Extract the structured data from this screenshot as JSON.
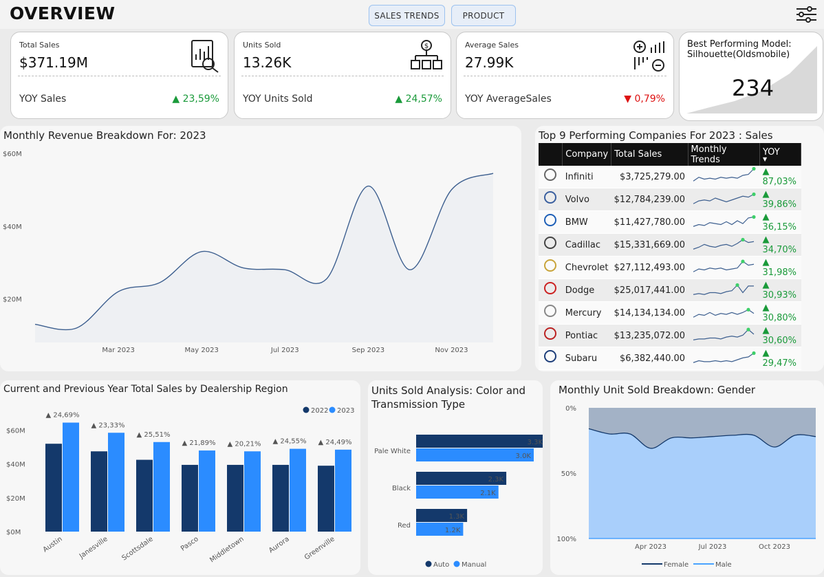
{
  "header": {
    "title": "OVERVIEW",
    "nav": [
      {
        "label": "SALES TRENDS"
      },
      {
        "label": "PRODUCT"
      }
    ]
  },
  "kpis": [
    {
      "label": "Total Sales",
      "value": "$371.19M",
      "yoy_label": "YOY Sales",
      "yoy_pct": "▲ 23,59%",
      "direction": "up",
      "icon": "report-magnifier-icon"
    },
    {
      "label": "Units Sold",
      "value": "13.26K",
      "yoy_label": "YOY Units Sold",
      "yoy_pct": "▲ 24,57%",
      "direction": "up",
      "icon": "dollar-boxes-icon"
    },
    {
      "label": "Average Sales",
      "value": "27.99K",
      "yoy_label": "YOY AverageSales",
      "yoy_pct": "▼ 0,79%",
      "direction": "down",
      "icon": "calc-chart-icon"
    }
  ],
  "best_model": {
    "label": "Best Performing Model:",
    "model": "Silhouette(Oldsmobile)",
    "value": "234"
  },
  "colors": {
    "navy": "#14396b",
    "blue": "#2b8cff",
    "line": "#3d5f8f",
    "up": "#1a9a3a",
    "down": "#dd1111",
    "spark_dot": "#3ecf6a"
  },
  "revenue_chart": {
    "title": "Monthly Revenue Breakdown For: 2023",
    "chart_data": {
      "type": "area",
      "x": [
        "Jan 2023",
        "Feb 2023",
        "Mar 2023",
        "Apr 2023",
        "May 2023",
        "Jun 2023",
        "Jul 2023",
        "Aug 2023",
        "Sep 2023",
        "Oct 2023",
        "Nov 2023",
        "Dec 2023"
      ],
      "x_tick_labels": [
        "Mar 2023",
        "May 2023",
        "Jul 2023",
        "Sep 2023",
        "Nov 2023"
      ],
      "y_tick_labels": [
        "$20M",
        "$40M",
        "$60M"
      ],
      "values": [
        13,
        12,
        22,
        24.5,
        33,
        28.5,
        28,
        25.5,
        51,
        28,
        50,
        54.5
      ],
      "ylim": [
        8,
        60
      ],
      "color": "#3d5f8f"
    }
  },
  "top9": {
    "title": "Top 9 Performing Companies For 2023 : Sales",
    "columns": [
      "Company",
      "Total Sales",
      "Monthly Trends",
      "YOY"
    ],
    "rows": [
      {
        "company": "Infiniti",
        "sales": "$3,725,279.00",
        "yoy": "▲ 87,03%",
        "trend": [
          3,
          5,
          4,
          4.5,
          4,
          5,
          4.5,
          5,
          4.5,
          6,
          6.5,
          9.5
        ]
      },
      {
        "company": "Volvo",
        "sales": "$12,784,239.00",
        "yoy": "▲ 39,86%",
        "trend": [
          3,
          4.5,
          5,
          4.5,
          6,
          5,
          4,
          5,
          6,
          7,
          6.5,
          8
        ]
      },
      {
        "company": "BMW",
        "sales": "$11,427,780.00",
        "yoy": "▲ 36,15%",
        "trend": [
          3,
          4,
          3.5,
          5,
          4.5,
          4,
          5.5,
          4,
          6,
          4.5,
          7.5,
          8
        ]
      },
      {
        "company": "Cadillac",
        "sales": "$15,331,669.00",
        "yoy": "▲ 34,70%",
        "trend": [
          3,
          4,
          5.5,
          4.5,
          4,
          5,
          5.5,
          4.5,
          6,
          8,
          6.5,
          7
        ]
      },
      {
        "company": "Chevrolet",
        "sales": "$27,112,493.00",
        "yoy": "▲ 31,98%",
        "trend": [
          3,
          4.5,
          4,
          5,
          4.5,
          5,
          4,
          4.5,
          5,
          8.5,
          6.5,
          7
        ]
      },
      {
        "company": "Dodge",
        "sales": "$25,017,441.00",
        "yoy": "▲ 30,93%",
        "trend": [
          3,
          3.5,
          3,
          4,
          4,
          3.5,
          4.5,
          5,
          8,
          4,
          7.5,
          7.5
        ]
      },
      {
        "company": "Mercury",
        "sales": "$14,134,134.00",
        "yoy": "▲ 30,80%",
        "trend": [
          3,
          4.5,
          4,
          5.5,
          4,
          5,
          4.5,
          5.5,
          4.5,
          5.5,
          7,
          5
        ]
      },
      {
        "company": "Pontiac",
        "sales": "$13,235,072.00",
        "yoy": "▲ 30,60%",
        "trend": [
          3,
          3.5,
          3.5,
          4,
          4,
          3.5,
          4.5,
          5,
          4.5,
          5.5,
          8.5,
          6
        ]
      },
      {
        "company": "Subaru",
        "sales": "$6,382,440.00",
        "yoy": "▲ 29,47%",
        "trend": [
          3,
          4,
          3.5,
          3.5,
          4,
          3.5,
          4,
          3.5,
          4.5,
          5.5,
          6,
          8
        ]
      }
    ]
  },
  "region_chart": {
    "title": "Current and Previous Year Total Sales by Dealership Region",
    "chart_data": {
      "type": "bar",
      "categories": [
        "Austin",
        "Janesville",
        "Scottsdale",
        "Pasco",
        "Middletown",
        "Aurora",
        "Greenville"
      ],
      "series": [
        {
          "name": "2022",
          "values": [
            52,
            47.5,
            42.5,
            39.5,
            39.5,
            39.5,
            39
          ],
          "color": "#14396b"
        },
        {
          "name": "2023",
          "values": [
            64.5,
            58.5,
            53,
            48,
            47.5,
            49,
            48.5
          ],
          "color": "#2b8cff"
        }
      ],
      "growth_labels": [
        "▲ 24,69%",
        "▲ 23,33%",
        "▲ 25,51%",
        "▲ 21,89%",
        "▲ 20,21%",
        "▲ 24,55%",
        "▲ 24,49%"
      ],
      "y_tick_labels": [
        "$0M",
        "$20M",
        "$40M",
        "$60M"
      ],
      "ylim": [
        0,
        70
      ],
      "legend": "top-right"
    }
  },
  "units_chart": {
    "title_line1": "Units Sold Analysis: Color and",
    "title_line2": "Transmission Type",
    "chart_data": {
      "type": "bar",
      "orientation": "horizontal",
      "categories": [
        "Pale White",
        "Black",
        "Red"
      ],
      "series": [
        {
          "name": "Auto",
          "values": [
            3.3,
            2.3,
            1.3
          ],
          "labels": [
            "3.3K",
            "2.3K",
            "1.3K"
          ],
          "color": "#14396b"
        },
        {
          "name": "Manual",
          "values": [
            3.0,
            2.1,
            1.2
          ],
          "labels": [
            "3.0K",
            "2.1K",
            "1.2K"
          ],
          "color": "#2b8cff"
        }
      ],
      "legend": "bottom"
    }
  },
  "gender_chart": {
    "title": "Monthly Unit Sold Breakdown: Gender",
    "chart_data": {
      "type": "area",
      "stacked_percent": true,
      "x": [
        "Jan 2023",
        "Feb 2023",
        "Mar 2023",
        "Apr 2023",
        "May 2023",
        "Jun 2023",
        "Jul 2023",
        "Aug 2023",
        "Sep 2023",
        "Oct 2023",
        "Nov 2023",
        "Dec 2023"
      ],
      "x_tick_labels": [
        "Apr 2023",
        "Jul 2023",
        "Oct 2023"
      ],
      "y_tick_labels": [
        "0%",
        "50%",
        "100%"
      ],
      "series": [
        {
          "name": "Female",
          "values": [
            16,
            20,
            20,
            31,
            23,
            23,
            22,
            21,
            21,
            30,
            21,
            22
          ],
          "color": "#14396b"
        },
        {
          "name": "Male",
          "values": [
            84,
            80,
            80,
            69,
            77,
            77,
            78,
            79,
            79,
            70,
            79,
            78
          ],
          "color": "#4aa3ff"
        }
      ],
      "legend": "bottom"
    }
  }
}
